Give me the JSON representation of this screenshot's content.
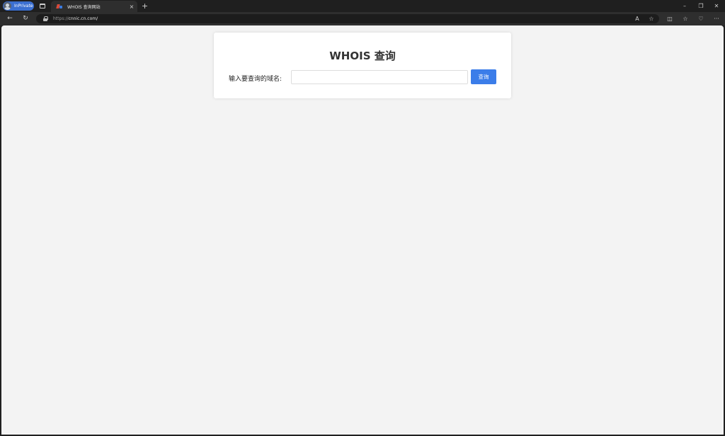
{
  "browser": {
    "inprivate_label": "InPrivate",
    "tab": {
      "title": "WHOIS 查询网站",
      "close": "×"
    },
    "new_tab": "+",
    "window": {
      "minimize": "–",
      "restore": "❐",
      "close": "✕"
    },
    "nav": {
      "back": "←",
      "refresh": "↻"
    },
    "address": {
      "scheme": "https://",
      "host": "cnnic.cn.com/"
    },
    "tools": {
      "read_aloud": "A",
      "favorite": "☆",
      "split": "◫",
      "favorites": "☆",
      "heart": "♡",
      "more": "···"
    }
  },
  "page": {
    "heading": "WHOIS 查询",
    "domain_label": "输入要查询的域名:",
    "domain_input": {
      "value": "",
      "placeholder": ""
    },
    "query_button": "查询"
  },
  "colors": {
    "accent": "#3b7de9",
    "inprivate": "#3b6fd0",
    "page_bg": "#f3f3f3"
  }
}
